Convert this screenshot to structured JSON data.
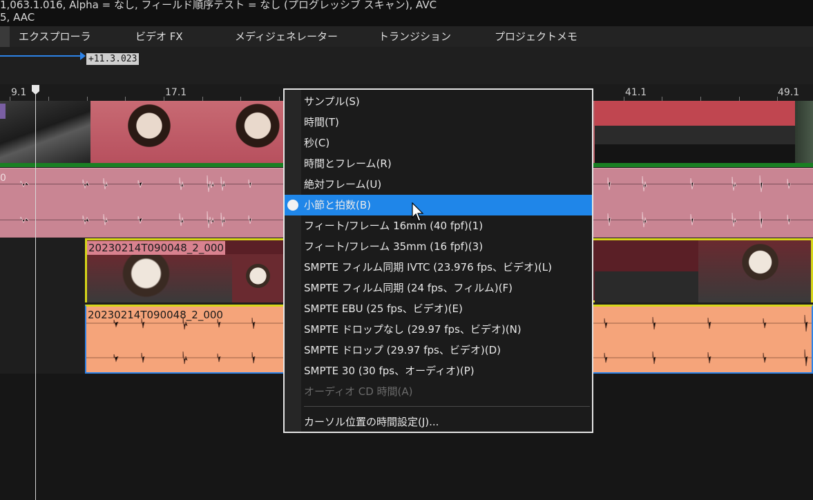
{
  "info": {
    "line1": "1,063.1.016, Alpha = なし, フィールド順序テスト = なし (プログレッシブ スキャン), AVC",
    "line2": "5, AAC"
  },
  "tabs": [
    "エクスプローラ",
    "ビデオ FX",
    "メディジェネレーター",
    "トランジション",
    "プロジェクトメモ"
  ],
  "selection_time": "+11.3.023",
  "ruler": [
    "9.1",
    "17.1",
    "41.1",
    "49.1"
  ],
  "track_markers": [
    "0",
    "0"
  ],
  "clips": {
    "video_name": "20230214T090048_2_000",
    "audio_name": "20230214T090048_2_000"
  },
  "menu": {
    "items": [
      {
        "label": "サンプル(S)",
        "selected": false,
        "disabled": false
      },
      {
        "label": "時間(T)",
        "selected": false,
        "disabled": false
      },
      {
        "label": "秒(C)",
        "selected": false,
        "disabled": false
      },
      {
        "label": "時間とフレーム(R)",
        "selected": false,
        "disabled": false
      },
      {
        "label": "絶対フレーム(U)",
        "selected": false,
        "disabled": false
      },
      {
        "label": "小節と拍数(B)",
        "selected": true,
        "disabled": false
      },
      {
        "label": "フィート/フレーム 16mm (40 fpf)(1)",
        "selected": false,
        "disabled": false
      },
      {
        "label": "フィート/フレーム 35mm (16 fpf)(3)",
        "selected": false,
        "disabled": false
      },
      {
        "label": "SMPTE フィルム同期 IVTC (23.976 fps、ビデオ)(L)",
        "selected": false,
        "disabled": false
      },
      {
        "label": "SMPTE フィルム同期 (24 fps、フィルム)(F)",
        "selected": false,
        "disabled": false
      },
      {
        "label": "SMPTE EBU (25 fps、ビデオ)(E)",
        "selected": false,
        "disabled": false
      },
      {
        "label": "SMPTE ドロップなし (29.97 fps、ビデオ)(N)",
        "selected": false,
        "disabled": false
      },
      {
        "label": "SMPTE ドロップ (29.97 fps、ビデオ)(D)",
        "selected": false,
        "disabled": false
      },
      {
        "label": "SMPTE 30 (30 fps、オーディオ)(P)",
        "selected": false,
        "disabled": false
      },
      {
        "label": "オーディオ CD 時間(A)",
        "selected": false,
        "disabled": true
      }
    ],
    "footer_item": "カーソル位置の時間設定(J)..."
  },
  "colors": {
    "menu_highlight": "#1f86e9",
    "audio_track1": "#c98593",
    "audio_clip": "#f5a47a",
    "clip_border_yellow": "#d6d61a",
    "selection_blue": "#2d83e8"
  }
}
